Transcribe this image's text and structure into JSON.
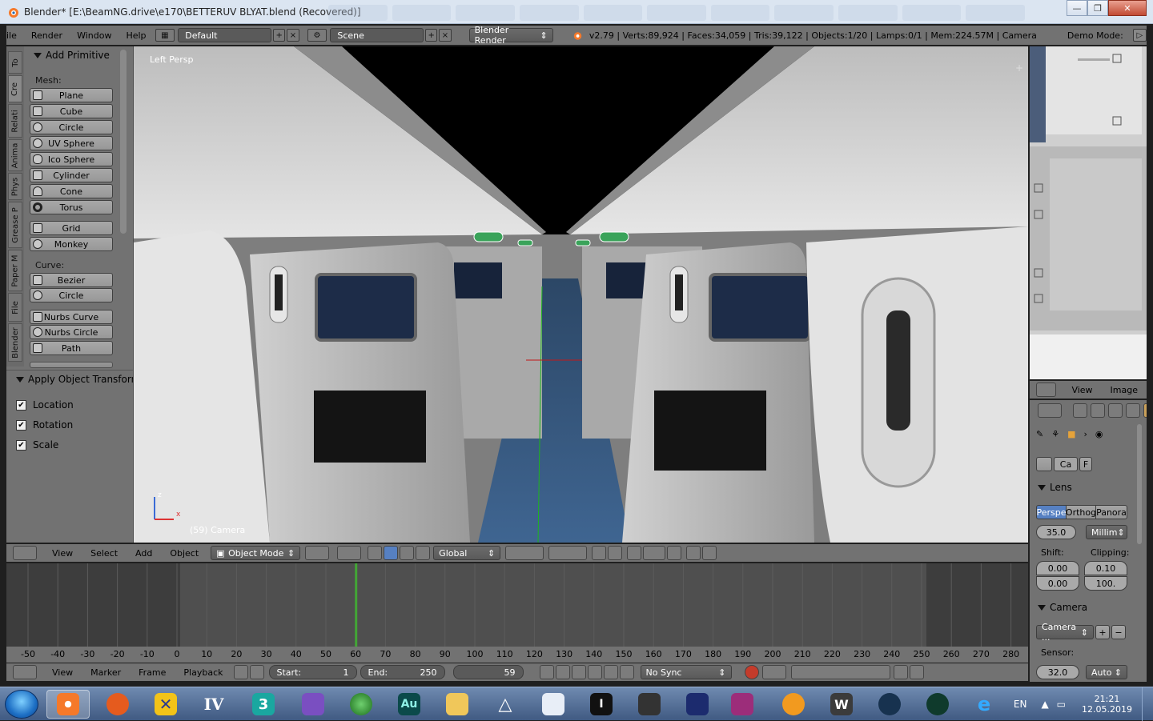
{
  "window": {
    "title": "Blender* [E:\\BeamNG.drive\\e170\\BETTERUV BLYAT.blend (Recovered)]",
    "controls": [
      "—",
      "❐",
      "✕"
    ]
  },
  "infobar": {
    "menus": [
      "File",
      "Render",
      "Window",
      "Help"
    ],
    "screen_layout": "Default",
    "scene": "Scene",
    "render_engine": "Blender Render",
    "stats": "v2.79 | Verts:89,924 | Faces:34,059 | Tris:39,122 | Objects:1/20 | Lamps:0/1 | Mem:224.57M | Camera",
    "demo_mode": "Demo Mode:"
  },
  "toolshelf": {
    "tabs": [
      "To",
      "Cre",
      "Relati",
      "Anima",
      "Phys",
      "Grease P",
      "Paper M",
      "File",
      "Blender"
    ],
    "panel_title": "Add Primitive",
    "mesh_label": "Mesh:",
    "mesh_buttons": [
      "Plane",
      "Cube",
      "Circle",
      "UV Sphere",
      "Ico Sphere",
      "Cylinder",
      "Cone",
      "Torus"
    ],
    "mesh_extra": [
      "Grid",
      "Monkey"
    ],
    "curve_label": "Curve:",
    "curve_buttons": [
      "Bezier",
      "Circle"
    ],
    "curve_extra": [
      "Nurbs Curve",
      "Nurbs Circle",
      "Path"
    ],
    "apply_panel_title": "Apply Object Transform",
    "apply_options": [
      "Location",
      "Rotation",
      "Scale"
    ]
  },
  "viewport": {
    "view_label": "Left Persp",
    "camera_label": "(59) Camera",
    "axis_x": "x",
    "axis_z": "z"
  },
  "viewport_header": {
    "menus": [
      "View",
      "Select",
      "Add",
      "Object"
    ],
    "mode": "Object Mode",
    "orientation": "Global"
  },
  "timeline": {
    "ruler": [
      "-50",
      "-40",
      "-30",
      "-20",
      "-10",
      "0",
      "10",
      "20",
      "30",
      "40",
      "50",
      "60",
      "70",
      "80",
      "90",
      "100",
      "110",
      "120",
      "130",
      "140",
      "150",
      "160",
      "170",
      "180",
      "190",
      "200",
      "210",
      "220",
      "230",
      "240",
      "250",
      "260",
      "270",
      "280"
    ],
    "current_frame_marker": 60,
    "footer_menus": [
      "View",
      "Marker",
      "Frame",
      "Playback"
    ],
    "start_label": "Start:",
    "start_value": "1",
    "end_label": "End:",
    "end_value": "250",
    "frame_value": "59",
    "sync": "No Sync"
  },
  "image_editor": {
    "menus": [
      "View",
      "Image"
    ]
  },
  "properties": {
    "data_tabs": [
      "Ca",
      "F"
    ],
    "lens_title": "Lens",
    "lens_types": [
      "Perspe",
      "Orthog",
      "Panora"
    ],
    "focal_length": "35.0",
    "lens_unit": "Millim",
    "shift_label": "Shift:",
    "shift_x": "0.00",
    "shift_y": "0.00",
    "clipping_label": "Clipping:",
    "clip_start": "0.10",
    "clip_end": "100.",
    "camera_title": "Camera",
    "camera_preset": "Camera ...",
    "sensor_label": "Sensor:",
    "sensor_value": "32.0",
    "sensor_fit": "Auto"
  },
  "taskbar": {
    "apps": [
      "start",
      "blender",
      "app-nodes",
      "xnview",
      "gta-iv",
      "3ds-max",
      "visual-studio",
      "earth",
      "audition",
      "explorer",
      "inkscape-like",
      "paper",
      "intellij",
      "synth",
      "piano-roll",
      "winrar",
      "sun-app",
      "w-app",
      "steam",
      "monitor",
      "internet-explorer"
    ],
    "iv_label": "IV",
    "max_label": "3",
    "au_label": "Au",
    "w_label": "W",
    "lang": "EN",
    "time": "21:21",
    "date": "12.05.2019"
  },
  "colors": {
    "panel": "#727272",
    "button": "#a0a0a0",
    "selected": "#5680c2",
    "timeline_bg": "#4f4f4f",
    "frame_marker": "#43a636"
  }
}
